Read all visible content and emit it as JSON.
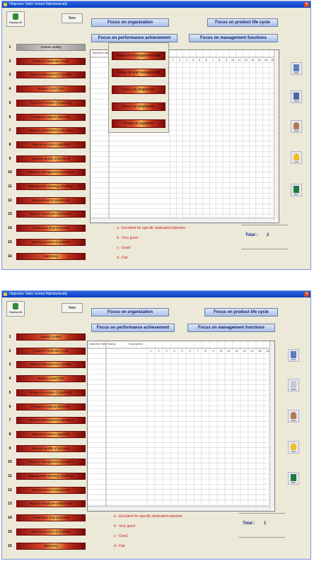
{
  "windows": [
    {
      "title": "Objective Table Sorted Alphabetically",
      "exit_label": "Display All",
      "new_label": "New",
      "focus": {
        "organization": "Focus on organization",
        "product_life_cycle": "Focus on product life cycle",
        "performance": "Focus on performance achievement",
        "management": "Focus on management functions"
      },
      "popup_items": [
        "Focus on management staff",
        "Focus on line management",
        "Focus on employees",
        "Focus on employees",
        "Focus on suppliers"
      ],
      "row_numbers": [
        "1",
        "2",
        "3",
        "4",
        "5",
        "6",
        "7",
        "8",
        "9",
        "10",
        "11",
        "12",
        "13",
        "14",
        "15",
        "16"
      ],
      "objectives": [
        "Sustain quality",
        "Reduce Production Costs",
        "Reduce Resources in Quality",
        "Reduce Lead Time",
        "Progress Analysis (Quarterly)",
        "Progress Analysis (Monthly)",
        "Improve performance indicators",
        "Improve process capability",
        "Improve quality of products",
        "Improve management dynamics",
        "Management strategy (Staffing)",
        "Improve level of production",
        "Improve employee satisfaction",
        "Continuous Improvements",
        "Develop process in addition",
        "Marketing"
      ],
      "grid_header": [
        "Objective title",
        "Rating",
        "Description"
      ],
      "col_numbers": [
        "1",
        "2",
        "3",
        "4",
        "5",
        "6",
        "7",
        "8",
        "9",
        "10",
        "11",
        "12",
        "13",
        "14",
        "15",
        "16"
      ],
      "legend": [
        "a - Excellent for specific dedicated objective",
        "b - Very good",
        "c - Good",
        "d - Fair"
      ],
      "total_label": "Total :",
      "total_value": "2",
      "side_buttons": [
        "Print",
        "Save",
        "Help",
        "Hint",
        "Exit"
      ]
    },
    {
      "title": "Objective Table Sorted Alphabetically",
      "exit_label": "Display All",
      "new_label": "New",
      "focus": {
        "organization": "Focus on organization",
        "product_life_cycle": "Focus on product life cycle",
        "performance": "Focus on performance achievement",
        "management": "Focus on management functions"
      },
      "row_numbers": [
        "1",
        "2",
        "3",
        "4",
        "5",
        "6",
        "7",
        "8",
        "9",
        "10",
        "11",
        "12",
        "13",
        "14",
        "15",
        "16"
      ],
      "objectives": [
        "Sustain quality",
        "Reduce Production Costs",
        "Reduce Resources in Quality",
        "Reduce Lead Time",
        "Progress Analysis (Quarterly)",
        "Progress Analysis (Monthly)",
        "Improve performance indicators",
        "Improve process capability",
        "Improve quality of products",
        "Improve management dynamics",
        "Management strategy (Staffing)",
        "Improve level of production",
        "Improve employee satisfaction",
        "Continuous Improvements",
        "Develop process in addition",
        "Marketing"
      ],
      "grid_header": [
        "Objective title",
        "Rating",
        "Description"
      ],
      "col_numbers": [
        "1",
        "2",
        "3",
        "4",
        "5",
        "6",
        "7",
        "8",
        "9",
        "10",
        "11",
        "12",
        "13",
        "14",
        "15",
        "16"
      ],
      "legend": [
        "a - Excellent for specific dedicated objective",
        "b - Very good",
        "c - Good",
        "d - Fair"
      ],
      "total_label": "Total :",
      "total_value": "1",
      "side_buttons": [
        "Print",
        "Save",
        "Help",
        "Hint",
        "Exit"
      ]
    }
  ],
  "colors": {
    "title_bar": "#0a3fc2",
    "legend_text": "#cc1a1a",
    "total_text": "#1a2a8a",
    "objective_dark": "#8c0f0f",
    "objective_light": "#f0b050"
  },
  "icons": {
    "exit": "door-icon",
    "print": "printer-icon",
    "save": "disk-icon",
    "help": "person-icon",
    "hint": "bulb-icon",
    "exit_side": "exit-door-icon"
  }
}
